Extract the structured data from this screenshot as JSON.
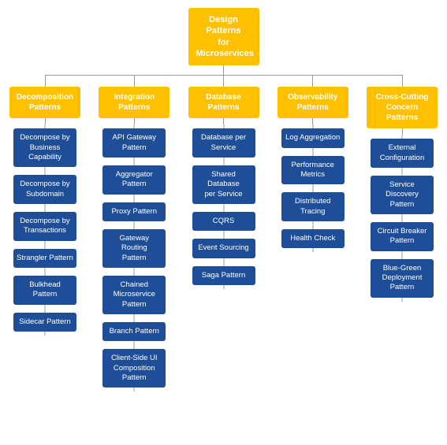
{
  "diagram": {
    "root": {
      "label": "Design Patterns\nfor Microservices"
    },
    "columns": [
      {
        "id": "decomposition",
        "header": "Decomposition\nPatterns",
        "items": [
          "Decompose by\nBusiness\nCapability",
          "Decompose by\nSubdomain",
          "Decompose by\nTransactions",
          "Strangler Pattern",
          "Bulkhead Pattern",
          "Sidecar Pattern"
        ]
      },
      {
        "id": "integration",
        "header": "Integration\nPatterns",
        "items": [
          "API Gateway\nPattern",
          "Aggregator\nPattern",
          "Proxy Pattern",
          "Gateway Routing\nPattern",
          "Chained\nMicroservice\nPattern",
          "Branch Pattern",
          "Client-Side UI\nComposition\nPattern"
        ]
      },
      {
        "id": "database",
        "header": "Database\nPatterns",
        "items": [
          "Database per\nService",
          "Shared Database\nper Service",
          "CQRS",
          "Event Sourcing",
          "Saga Pattern"
        ]
      },
      {
        "id": "observability",
        "header": "Observability\nPatterns",
        "items": [
          "Log Aggregation",
          "Performance\nMetrics",
          "Distributed\nTracing",
          "Health Check"
        ]
      },
      {
        "id": "crosscutting",
        "header": "Cross-Cutting\nConcern Patterns",
        "items": [
          "External\nConfiguration",
          "Service Discovery\nPattern",
          "Circuit Breaker\nPattern",
          "Blue-Green\nDeployment\nPattern"
        ]
      }
    ]
  }
}
